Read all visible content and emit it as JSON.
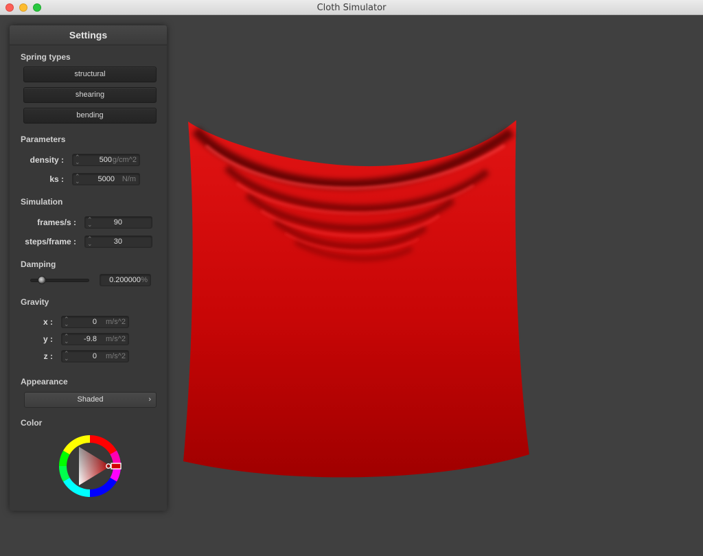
{
  "window": {
    "title": "Cloth Simulator"
  },
  "panel": {
    "title": "Settings",
    "spring_types": {
      "label": "Spring types",
      "buttons": [
        "structural",
        "shearing",
        "bending"
      ]
    },
    "parameters": {
      "label": "Parameters",
      "density": {
        "label": "density :",
        "value": "500",
        "unit": "g/cm^2"
      },
      "ks": {
        "label": "ks :",
        "value": "5000",
        "unit": "N/m"
      }
    },
    "simulation": {
      "label": "Simulation",
      "frames": {
        "label": "frames/s :",
        "value": "90"
      },
      "steps": {
        "label": "steps/frame :",
        "value": "30"
      }
    },
    "damping": {
      "label": "Damping",
      "value": "0.200000",
      "unit": "%",
      "slider_fraction": 0.2
    },
    "gravity": {
      "label": "Gravity",
      "x": {
        "label": "x :",
        "value": "0",
        "unit": "m/s^2"
      },
      "y": {
        "label": "y :",
        "value": "-9.8",
        "unit": "m/s^2"
      },
      "z": {
        "label": "z :",
        "value": "0",
        "unit": "m/s^2"
      }
    },
    "appearance": {
      "label": "Appearance",
      "selected": "Shaded"
    },
    "color": {
      "label": "Color",
      "value": "#d10000"
    }
  },
  "colors": {
    "background": "#404040",
    "cloth": "#d10000",
    "panel": "#383838"
  },
  "icons": {
    "window_close": "close-icon",
    "window_minimize": "minimize-icon",
    "window_maximize": "maximize-icon",
    "popup_arrow": "chevron-right-icon",
    "spinner": "spinner-arrows-icon"
  }
}
